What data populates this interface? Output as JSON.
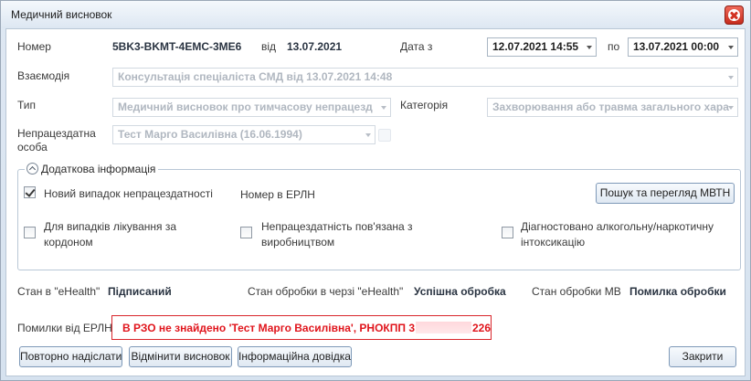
{
  "window": {
    "title": "Медичний висновок"
  },
  "header": {
    "number_label": "Номер",
    "number_value": "5BK3-BKMT-4EMC-3ME6",
    "from_label": "від",
    "from_date": "13.07.2021",
    "date_from_label": "Дата з",
    "date_from_value": "12.07.2021 14:55",
    "date_to_label": "по",
    "date_to_value": "13.07.2021 00:00"
  },
  "fields": {
    "interaction_label": "Взаємодія",
    "interaction_value": "Консультація спеціаліста СМД від 13.07.2021 14:48",
    "type_label": "Тип",
    "type_value": "Медичний висновок про тимчасову непрацезд",
    "category_label": "Категорія",
    "category_value": "Захворювання або травма загального хара",
    "person_label_line1": "Непрацездатна",
    "person_label_line2": "особа",
    "person_value": "Тест Марго Василівна (16.06.1994)"
  },
  "additional": {
    "title": "Додаткова інформація",
    "new_case_label": "Новий випадок непрацездатності",
    "new_case_checked": true,
    "erln_number_label": "Номер в ЕРЛН",
    "search_button": "Пошук та перегляд МВТН",
    "abroad_label_line1": "Для випадків лікування за",
    "abroad_label_line2": "кордоном",
    "abroad_checked": false,
    "work_related_label_line1": "Непрацездатність пов'язана з",
    "work_related_label_line2": "виробництвом",
    "work_related_checked": false,
    "alcohol_label_line1": "Діагностовано алкогольну/наркотичну",
    "alcohol_label_line2": "інтоксикацію",
    "alcohol_checked": false
  },
  "status": {
    "ehealth_label": "Стан в \"eHealth\"",
    "ehealth_value": "Підписаний",
    "queue_label": "Стан обробки в черзі \"eHealth\"",
    "queue_value": "Успішна обробка",
    "mv_label": "Стан обробки МВ",
    "mv_value": "Помилка обробки"
  },
  "errors": {
    "label": "Помилки від ЕРЛН",
    "message_prefix": "В РЗО не знайдено 'Тест Марго Василівна', РНОКПП 3",
    "message_suffix": "226",
    "color": "#e0151c"
  },
  "footer": {
    "resend_button": "Повторно надіслати",
    "cancel_button": "Відмінити висновок",
    "info_button": "Інформаційна довідка",
    "close_button": "Закрити"
  }
}
